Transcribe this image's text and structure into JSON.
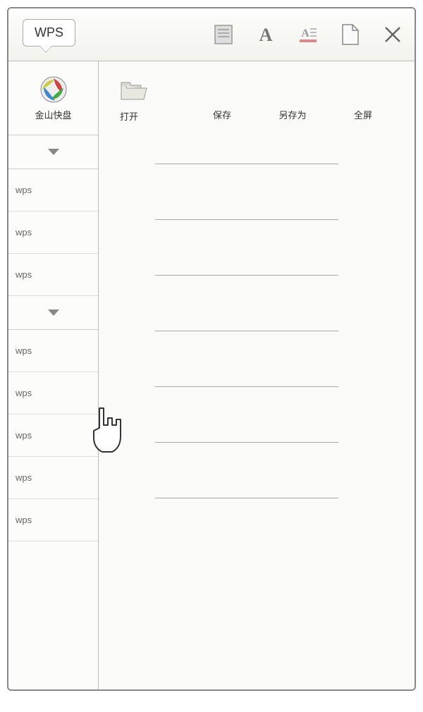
{
  "titlebar": {
    "app_name": "WPS"
  },
  "sidebar": {
    "header_label": "金山快盘",
    "group1": [
      {
        "label": "wps"
      },
      {
        "label": "wps"
      },
      {
        "label": "wps"
      }
    ],
    "group2": [
      {
        "label": "wps"
      },
      {
        "label": "wps"
      },
      {
        "label": "wps"
      },
      {
        "label": "wps"
      },
      {
        "label": "wps"
      }
    ]
  },
  "toolbar": {
    "open": "打开",
    "save": "保存",
    "saveas": "另存为",
    "fullscreen": "全屏"
  }
}
